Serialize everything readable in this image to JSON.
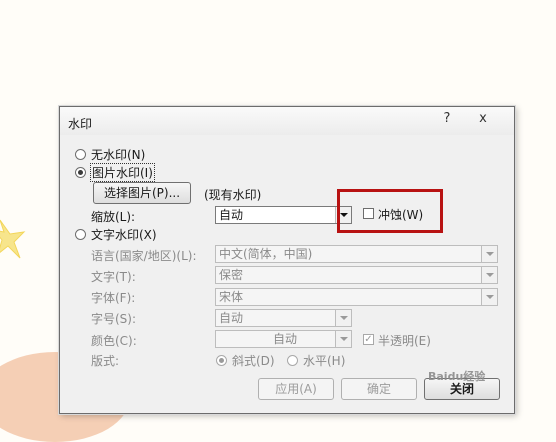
{
  "dialog": {
    "title": "水印",
    "help_label": "?",
    "close_label": "x"
  },
  "options": {
    "no_watermark": "无水印(N)",
    "picture_watermark": "图片水印(I)",
    "text_watermark": "文字水印(X)",
    "selected": "picture_watermark"
  },
  "picture": {
    "select_button": "选择图片(P)...",
    "current_status": "(现有水印)",
    "scale_label": "缩放(L):",
    "scale_value": "自动",
    "washout_label": "冲蚀(W)",
    "washout_checked": false
  },
  "text": {
    "language_label": "语言(国家/地区)(L):",
    "language_value": "中文(简体，中国)",
    "text_label": "文字(T):",
    "text_value": "保密",
    "font_label": "字体(F):",
    "font_value": "宋体",
    "size_label": "字号(S):",
    "size_value": "自动",
    "color_label": "颜色(C):",
    "color_value": "自动",
    "semitransparent_label": "半透明(E)",
    "semitransparent_checked": true,
    "layout_label": "版式:",
    "layout_diagonal": "斜式(D)",
    "layout_horizontal": "水平(H)",
    "layout_selected": "diagonal"
  },
  "buttons": {
    "apply": "应用(A)",
    "ok": "确定",
    "close": "关闭"
  },
  "annotation_color": "#b81212",
  "page_watermark": {
    "brand": "Baidu",
    "suffix": "经验"
  }
}
